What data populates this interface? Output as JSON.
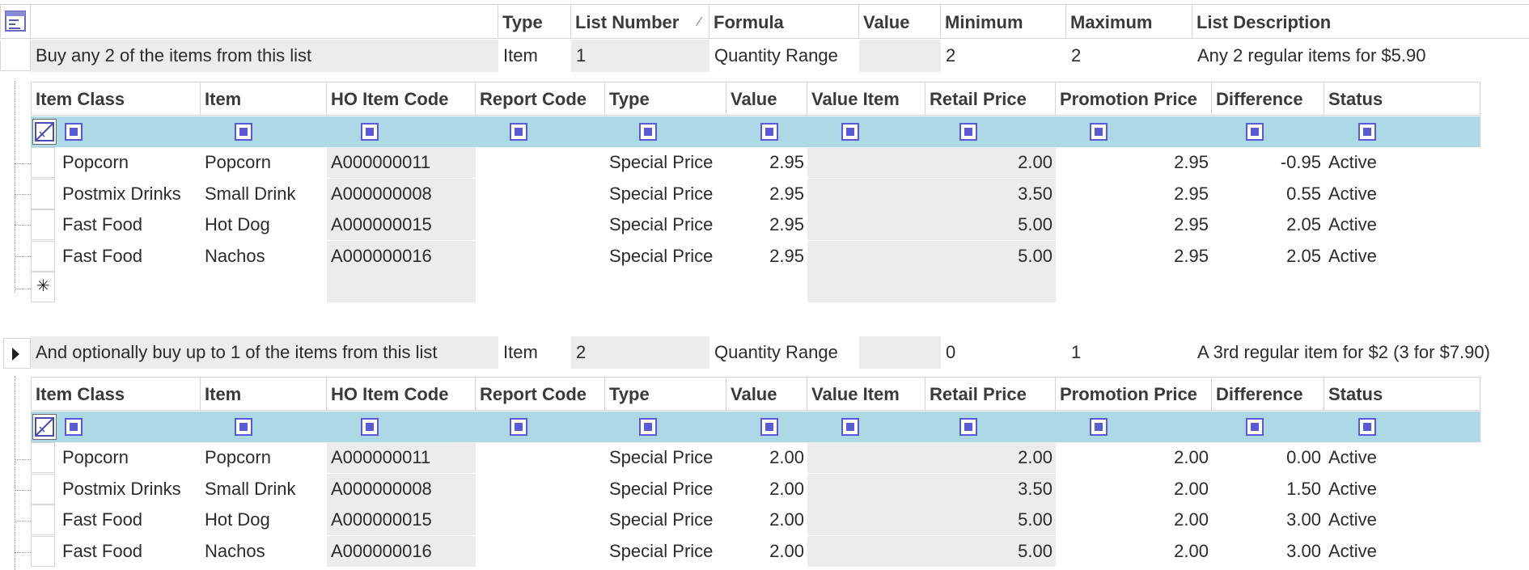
{
  "columns": {
    "type": "Type",
    "list_number": "List Number",
    "formula": "Formula",
    "value": "Value",
    "minimum": "Minimum",
    "maximum": "Maximum",
    "list_description": "List Description"
  },
  "sub_columns": [
    "Item Class",
    "Item",
    "HO Item Code",
    "Report Code",
    "Type",
    "Value",
    "Value Item",
    "Retail Price",
    "Promotion Price",
    "Difference",
    "Status"
  ],
  "lists": [
    {
      "description": "Buy any 2 of the items from this list",
      "type": "Item",
      "list_number": "1",
      "formula": "Quantity Range",
      "value": "",
      "minimum": "2",
      "maximum": "2",
      "list_description": "Any 2 regular items for $5.90",
      "items": [
        {
          "item_class": "Popcorn",
          "item": "Popcorn",
          "ho_item_code": "A000000011",
          "report_code": "",
          "type": "Special Price",
          "value": "2.95",
          "value_item": "",
          "retail_price": "2.00",
          "promotion_price": "2.95",
          "difference": "-0.95",
          "status": "Active"
        },
        {
          "item_class": "Postmix Drinks",
          "item": "Small Drink",
          "ho_item_code": "A000000008",
          "report_code": "",
          "type": "Special Price",
          "value": "2.95",
          "value_item": "",
          "retail_price": "3.50",
          "promotion_price": "2.95",
          "difference": "0.55",
          "status": "Active"
        },
        {
          "item_class": "Fast Food",
          "item": "Hot Dog",
          "ho_item_code": "A000000015",
          "report_code": "",
          "type": "Special Price",
          "value": "2.95",
          "value_item": "",
          "retail_price": "5.00",
          "promotion_price": "2.95",
          "difference": "2.05",
          "status": "Active"
        },
        {
          "item_class": "Fast Food",
          "item": "Nachos",
          "ho_item_code": "A000000016",
          "report_code": "",
          "type": "Special Price",
          "value": "2.95",
          "value_item": "",
          "retail_price": "5.00",
          "promotion_price": "2.95",
          "difference": "2.05",
          "status": "Active"
        }
      ]
    },
    {
      "description": "And optionally buy up to 1 of the items from this list",
      "type": "Item",
      "list_number": "2",
      "formula": "Quantity Range",
      "value": "",
      "minimum": "0",
      "maximum": "1",
      "list_description": "A 3rd regular item for $2 (3 for $7.90)",
      "items": [
        {
          "item_class": "Popcorn",
          "item": "Popcorn",
          "ho_item_code": "A000000011",
          "report_code": "",
          "type": "Special Price",
          "value": "2.00",
          "value_item": "",
          "retail_price": "2.00",
          "promotion_price": "2.00",
          "difference": "0.00",
          "status": "Active"
        },
        {
          "item_class": "Postmix Drinks",
          "item": "Small Drink",
          "ho_item_code": "A000000008",
          "report_code": "",
          "type": "Special Price",
          "value": "2.00",
          "value_item": "",
          "retail_price": "3.50",
          "promotion_price": "2.00",
          "difference": "1.50",
          "status": "Active"
        },
        {
          "item_class": "Fast Food",
          "item": "Hot Dog",
          "ho_item_code": "A000000015",
          "report_code": "",
          "type": "Special Price",
          "value": "2.00",
          "value_item": "",
          "retail_price": "5.00",
          "promotion_price": "2.00",
          "difference": "3.00",
          "status": "Active"
        },
        {
          "item_class": "Fast Food",
          "item": "Nachos",
          "ho_item_code": "A000000016",
          "report_code": "",
          "type": "Special Price",
          "value": "2.00",
          "value_item": "",
          "retail_price": "5.00",
          "promotion_price": "2.00",
          "difference": "3.00",
          "status": "Active"
        }
      ]
    }
  ],
  "icons": {
    "column_chooser": "column-chooser-icon",
    "filter_toggle": "filter-toggle-icon",
    "new_row": "new-row-icon",
    "expand": "expand-arrow-icon",
    "sort": "sort-icon"
  },
  "colors": {
    "filter_row": "#add8e6",
    "filter_box": "#5a5ad8",
    "shaded_cell": "#ececec"
  }
}
